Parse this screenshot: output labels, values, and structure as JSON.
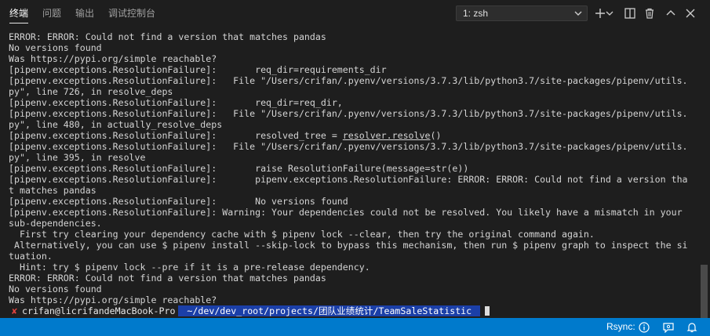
{
  "panel": {
    "tabs": [
      {
        "label": "终端",
        "active": true
      },
      {
        "label": "问题",
        "active": false
      },
      {
        "label": "输出",
        "active": false
      },
      {
        "label": "调试控制台",
        "active": false
      }
    ],
    "terminal_select": {
      "value": "1: zsh"
    },
    "actions": [
      "add-icon",
      "chevron-down-icon",
      "split-icon",
      "trash-icon",
      "chevron-up-icon",
      "close-icon"
    ]
  },
  "terminal": {
    "lines": [
      "ERROR: ERROR: Could not find a version that matches pandas",
      "No versions found",
      "Was https://pypi.org/simple reachable?",
      "[pipenv.exceptions.ResolutionFailure]:       req_dir=requirements_dir",
      "[pipenv.exceptions.ResolutionFailure]:   File \"/Users/crifan/.pyenv/versions/3.7.3/lib/python3.7/site-packages/pipenv/utils.",
      "py\", line 726, in resolve_deps",
      "[pipenv.exceptions.ResolutionFailure]:       req_dir=req_dir,",
      "[pipenv.exceptions.ResolutionFailure]:   File \"/Users/crifan/.pyenv/versions/3.7.3/lib/python3.7/site-packages/pipenv/utils.",
      "py\", line 480, in actually_resolve_deps",
      "__RESOLVER__",
      "[pipenv.exceptions.ResolutionFailure]:   File \"/Users/crifan/.pyenv/versions/3.7.3/lib/python3.7/site-packages/pipenv/utils.",
      "py\", line 395, in resolve",
      "[pipenv.exceptions.ResolutionFailure]:       raise ResolutionFailure(message=str(e))",
      "[pipenv.exceptions.ResolutionFailure]:       pipenv.exceptions.ResolutionFailure: ERROR: ERROR: Could not find a version tha",
      "t matches pandas",
      "[pipenv.exceptions.ResolutionFailure]:       No versions found",
      "[pipenv.exceptions.ResolutionFailure]: Warning: Your dependencies could not be resolved. You likely have a mismatch in your",
      "sub-dependencies.",
      "  First try clearing your dependency cache with $ pipenv lock --clear, then try the original command again.",
      " Alternatively, you can use $ pipenv install --skip-lock to bypass this mechanism, then run $ pipenv graph to inspect the si",
      "tuation.",
      "  Hint: try $ pipenv lock --pre if it is a pre-release dependency.",
      "ERROR: ERROR: Could not find a version that matches pandas",
      "No versions found",
      "Was https://pypi.org/simple reachable?"
    ],
    "resolver_line": {
      "prefix": "[pipenv.exceptions.ResolutionFailure]:       resolved_tree = ",
      "underlined": "resolver.resolve",
      "suffix": "()"
    },
    "prompt": {
      "status_glyph": "✘",
      "user_host": "crifan@licrifandeMacBook-Pro",
      "path": " ~/dev/dev_root/projects/团队业绩统计/TeamSaleStatistic "
    }
  },
  "statusbar": {
    "sync_label": "Rsync:",
    "icons": [
      "info-icon",
      "feedback-icon",
      "bell-icon"
    ],
    "background": "#007acc"
  }
}
